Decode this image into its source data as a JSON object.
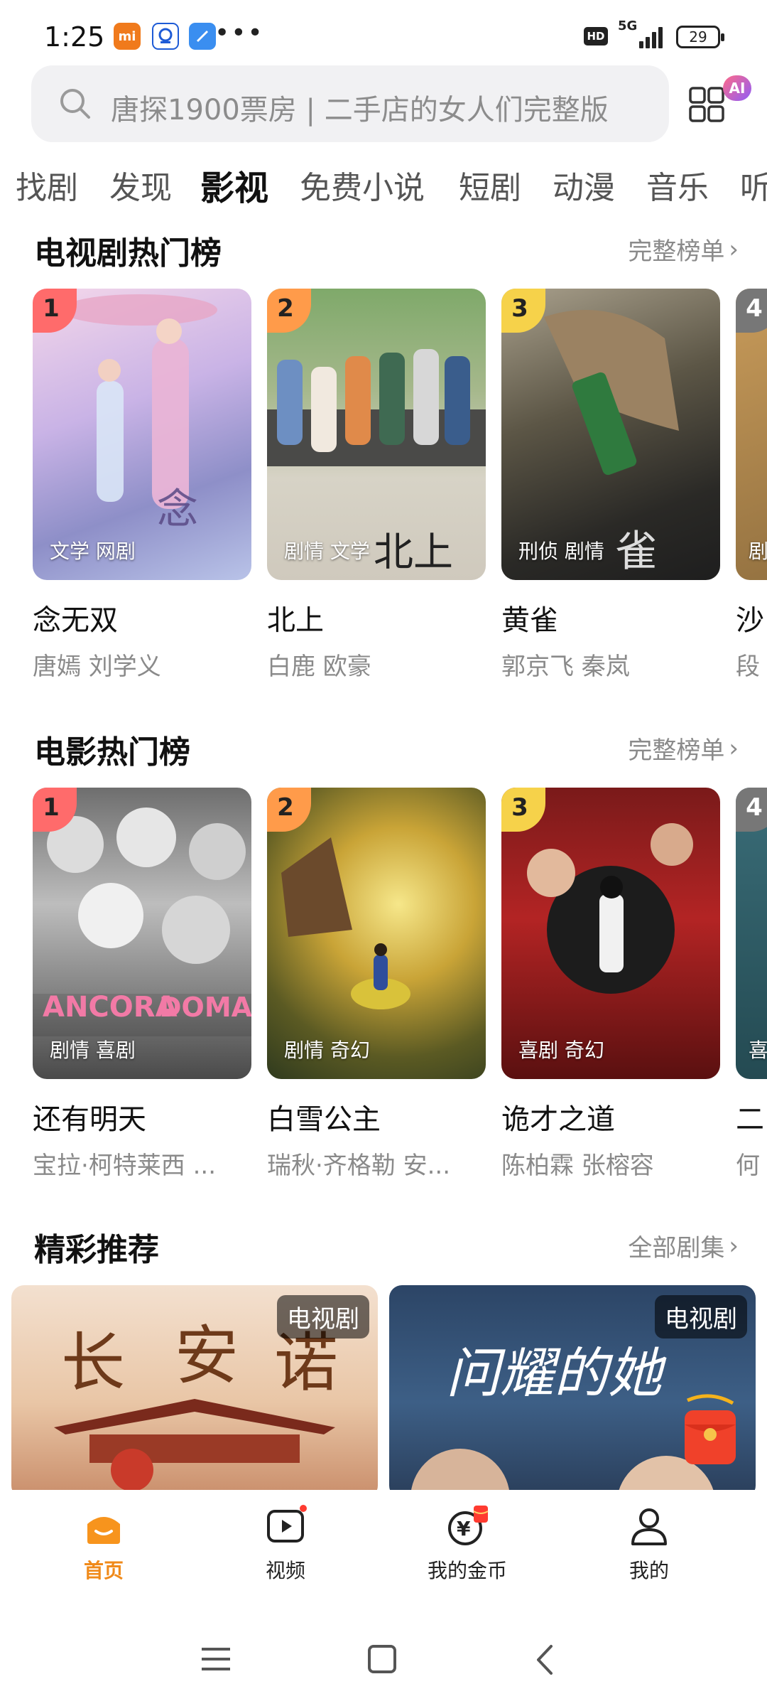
{
  "status_bar": {
    "time": "1:25",
    "icons": [
      "mi-app-icon",
      "bank-app-icon",
      "cloud-app-icon"
    ],
    "more": "•••",
    "hd": "HD",
    "network": "5G",
    "battery": "29"
  },
  "search": {
    "placeholder": "唐探1900票房 | 二手店的女人们完整版",
    "ai_badge": "AI"
  },
  "tabs": [
    "找剧",
    "发现",
    "影视",
    "免费小说",
    "短剧",
    "动漫",
    "音乐",
    "听"
  ],
  "active_tab": "影视",
  "tv_rank": {
    "title": "电视剧热门榜",
    "more": "完整榜单",
    "items": [
      {
        "rank": "1",
        "tags": "文学 网剧",
        "title": "念无双",
        "actors": "唐嫣 刘学义",
        "rank_color": "#ff6b6b"
      },
      {
        "rank": "2",
        "tags": "剧情 文学",
        "title": "北上",
        "actors": "白鹿 欧豪",
        "rank_color": "#ff9b4a"
      },
      {
        "rank": "3",
        "tags": "刑侦 剧情",
        "title": "黄雀",
        "actors": "郭京飞 秦岚",
        "rank_color": "#f6d24a"
      },
      {
        "rank": "4",
        "tags": "剧",
        "title": "沙",
        "actors": "段",
        "rank_color": "#9a9a9a"
      }
    ]
  },
  "movie_rank": {
    "title": "电影热门榜",
    "more": "完整榜单",
    "items": [
      {
        "rank": "1",
        "tags": "剧情 喜剧",
        "title": "还有明天",
        "actors": "宝拉·柯特莱西 ...",
        "rank_color": "#ff6b6b"
      },
      {
        "rank": "2",
        "tags": "剧情 奇幻",
        "title": "白雪公主",
        "actors": "瑞秋·齐格勒 安...",
        "rank_color": "#ff9b4a"
      },
      {
        "rank": "3",
        "tags": "喜剧 奇幻",
        "title": "诡才之道",
        "actors": "陈柏霖 张榕容",
        "rank_color": "#f6d24a"
      },
      {
        "rank": "4",
        "tags": "喜",
        "title": "二",
        "actors": "何",
        "rank_color": "#9a9a9a"
      }
    ]
  },
  "recommend": {
    "title": "精彩推荐",
    "more": "全部剧集",
    "items": [
      {
        "badge": "电视剧"
      },
      {
        "badge": "电视剧"
      }
    ]
  },
  "bottom_nav": [
    {
      "label": "首页",
      "icon": "home-icon"
    },
    {
      "label": "视频",
      "icon": "video-play-icon"
    },
    {
      "label": "我的金币",
      "icon": "coin-icon"
    },
    {
      "label": "我的",
      "icon": "profile-icon"
    }
  ],
  "active_nav": "首页",
  "colors": {
    "accent": "#f08a1a",
    "rank1": "#ff6b6b",
    "rank2": "#ff9b4a",
    "rank3": "#f6d24a"
  }
}
